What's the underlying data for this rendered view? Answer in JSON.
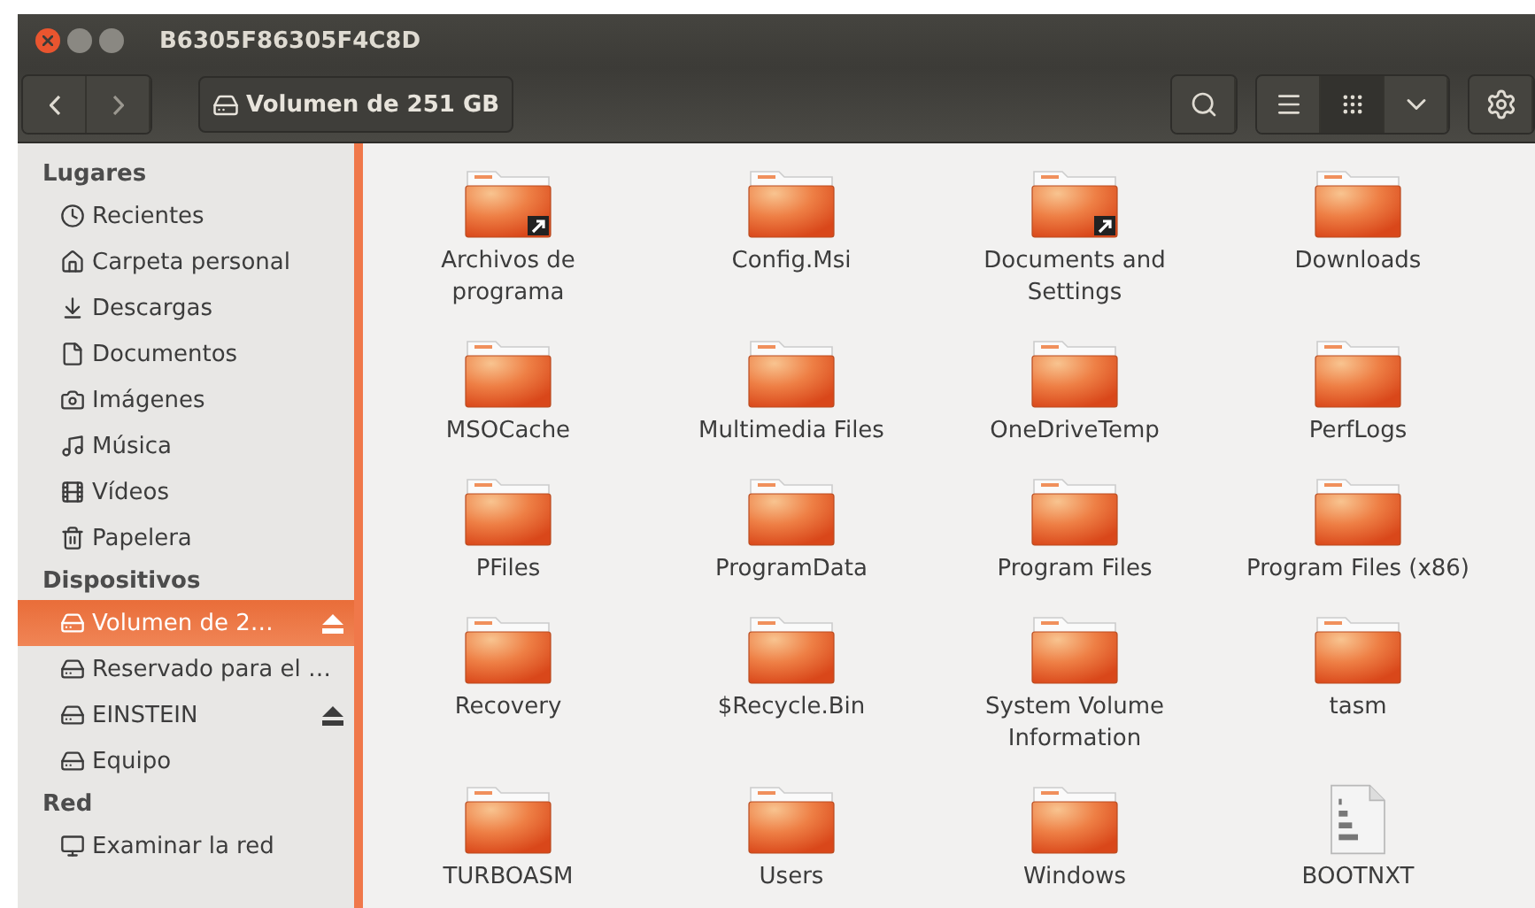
{
  "window": {
    "title": "B6305F86305F4C8D"
  },
  "toolbar": {
    "path": "Volumen de 251 GB",
    "views": [
      {
        "kind": "list",
        "selected": false
      },
      {
        "kind": "grid",
        "selected": true
      }
    ]
  },
  "sidebar": {
    "sections": [
      {
        "heading": "Lugares",
        "items": [
          {
            "kind": "recent",
            "label": "Recientes",
            "selected": false
          },
          {
            "kind": "home",
            "label": "Carpeta personal",
            "selected": false
          },
          {
            "kind": "download",
            "label": "Descargas",
            "selected": false
          },
          {
            "kind": "document",
            "label": "Documentos",
            "selected": false
          },
          {
            "kind": "camera",
            "label": "Imágenes",
            "selected": false
          },
          {
            "kind": "music",
            "label": "Música",
            "selected": false
          },
          {
            "kind": "film",
            "label": "Vídeos",
            "selected": false
          },
          {
            "kind": "trash",
            "label": "Papelera",
            "selected": false
          }
        ]
      },
      {
        "heading": "Dispositivos",
        "items": [
          {
            "kind": "disk",
            "label": "Volumen de 2…",
            "selected": true,
            "ejectable": true
          },
          {
            "kind": "disk",
            "label": "Reservado para el …",
            "selected": false,
            "ejectable": false
          },
          {
            "kind": "drive",
            "label": "EINSTEIN",
            "selected": false,
            "ejectable": true
          },
          {
            "kind": "disk",
            "label": "Equipo",
            "selected": false,
            "ejectable": false
          }
        ]
      },
      {
        "heading": "Red",
        "items": [
          {
            "kind": "network",
            "label": "Examinar la red",
            "selected": false
          }
        ]
      }
    ]
  },
  "files": [
    {
      "kind": "folder-link",
      "name": "Archivos de programa"
    },
    {
      "kind": "folder",
      "name": "Config.Msi"
    },
    {
      "kind": "folder-link",
      "name": "Documents and Settings"
    },
    {
      "kind": "folder",
      "name": "Downloads"
    },
    {
      "kind": "folder",
      "name": "MSOCache"
    },
    {
      "kind": "folder",
      "name": "Multimedia Files"
    },
    {
      "kind": "folder",
      "name": "OneDriveTemp"
    },
    {
      "kind": "folder",
      "name": "PerfLogs"
    },
    {
      "kind": "folder",
      "name": "PFiles"
    },
    {
      "kind": "folder",
      "name": "ProgramData"
    },
    {
      "kind": "folder",
      "name": "Program Files"
    },
    {
      "kind": "folder",
      "name": "Program Files (x86)"
    },
    {
      "kind": "folder",
      "name": "Recovery"
    },
    {
      "kind": "folder",
      "name": "$Recycle.Bin"
    },
    {
      "kind": "folder",
      "name": "System Volume Information"
    },
    {
      "kind": "folder",
      "name": "tasm"
    },
    {
      "kind": "folder",
      "name": "TURBOASM"
    },
    {
      "kind": "folder",
      "name": "Users"
    },
    {
      "kind": "folder",
      "name": "Windows"
    },
    {
      "kind": "binary",
      "name": "BOOTNXT"
    }
  ]
}
